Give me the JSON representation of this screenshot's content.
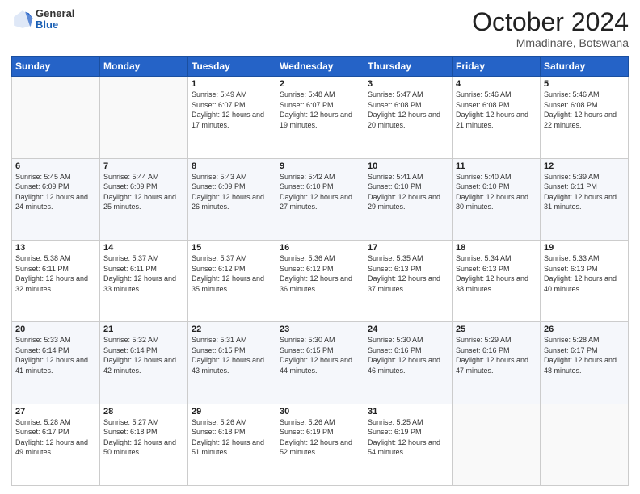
{
  "logo": {
    "general": "General",
    "blue": "Blue"
  },
  "header": {
    "month_year": "October 2024",
    "location": "Mmadinare, Botswana"
  },
  "days_of_week": [
    "Sunday",
    "Monday",
    "Tuesday",
    "Wednesday",
    "Thursday",
    "Friday",
    "Saturday"
  ],
  "weeks": [
    [
      {
        "day": "",
        "sunrise": "",
        "sunset": "",
        "daylight": ""
      },
      {
        "day": "",
        "sunrise": "",
        "sunset": "",
        "daylight": ""
      },
      {
        "day": "1",
        "sunrise": "Sunrise: 5:49 AM",
        "sunset": "Sunset: 6:07 PM",
        "daylight": "Daylight: 12 hours and 17 minutes."
      },
      {
        "day": "2",
        "sunrise": "Sunrise: 5:48 AM",
        "sunset": "Sunset: 6:07 PM",
        "daylight": "Daylight: 12 hours and 19 minutes."
      },
      {
        "day": "3",
        "sunrise": "Sunrise: 5:47 AM",
        "sunset": "Sunset: 6:08 PM",
        "daylight": "Daylight: 12 hours and 20 minutes."
      },
      {
        "day": "4",
        "sunrise": "Sunrise: 5:46 AM",
        "sunset": "Sunset: 6:08 PM",
        "daylight": "Daylight: 12 hours and 21 minutes."
      },
      {
        "day": "5",
        "sunrise": "Sunrise: 5:46 AM",
        "sunset": "Sunset: 6:08 PM",
        "daylight": "Daylight: 12 hours and 22 minutes."
      }
    ],
    [
      {
        "day": "6",
        "sunrise": "Sunrise: 5:45 AM",
        "sunset": "Sunset: 6:09 PM",
        "daylight": "Daylight: 12 hours and 24 minutes."
      },
      {
        "day": "7",
        "sunrise": "Sunrise: 5:44 AM",
        "sunset": "Sunset: 6:09 PM",
        "daylight": "Daylight: 12 hours and 25 minutes."
      },
      {
        "day": "8",
        "sunrise": "Sunrise: 5:43 AM",
        "sunset": "Sunset: 6:09 PM",
        "daylight": "Daylight: 12 hours and 26 minutes."
      },
      {
        "day": "9",
        "sunrise": "Sunrise: 5:42 AM",
        "sunset": "Sunset: 6:10 PM",
        "daylight": "Daylight: 12 hours and 27 minutes."
      },
      {
        "day": "10",
        "sunrise": "Sunrise: 5:41 AM",
        "sunset": "Sunset: 6:10 PM",
        "daylight": "Daylight: 12 hours and 29 minutes."
      },
      {
        "day": "11",
        "sunrise": "Sunrise: 5:40 AM",
        "sunset": "Sunset: 6:10 PM",
        "daylight": "Daylight: 12 hours and 30 minutes."
      },
      {
        "day": "12",
        "sunrise": "Sunrise: 5:39 AM",
        "sunset": "Sunset: 6:11 PM",
        "daylight": "Daylight: 12 hours and 31 minutes."
      }
    ],
    [
      {
        "day": "13",
        "sunrise": "Sunrise: 5:38 AM",
        "sunset": "Sunset: 6:11 PM",
        "daylight": "Daylight: 12 hours and 32 minutes."
      },
      {
        "day": "14",
        "sunrise": "Sunrise: 5:37 AM",
        "sunset": "Sunset: 6:11 PM",
        "daylight": "Daylight: 12 hours and 33 minutes."
      },
      {
        "day": "15",
        "sunrise": "Sunrise: 5:37 AM",
        "sunset": "Sunset: 6:12 PM",
        "daylight": "Daylight: 12 hours and 35 minutes."
      },
      {
        "day": "16",
        "sunrise": "Sunrise: 5:36 AM",
        "sunset": "Sunset: 6:12 PM",
        "daylight": "Daylight: 12 hours and 36 minutes."
      },
      {
        "day": "17",
        "sunrise": "Sunrise: 5:35 AM",
        "sunset": "Sunset: 6:13 PM",
        "daylight": "Daylight: 12 hours and 37 minutes."
      },
      {
        "day": "18",
        "sunrise": "Sunrise: 5:34 AM",
        "sunset": "Sunset: 6:13 PM",
        "daylight": "Daylight: 12 hours and 38 minutes."
      },
      {
        "day": "19",
        "sunrise": "Sunrise: 5:33 AM",
        "sunset": "Sunset: 6:13 PM",
        "daylight": "Daylight: 12 hours and 40 minutes."
      }
    ],
    [
      {
        "day": "20",
        "sunrise": "Sunrise: 5:33 AM",
        "sunset": "Sunset: 6:14 PM",
        "daylight": "Daylight: 12 hours and 41 minutes."
      },
      {
        "day": "21",
        "sunrise": "Sunrise: 5:32 AM",
        "sunset": "Sunset: 6:14 PM",
        "daylight": "Daylight: 12 hours and 42 minutes."
      },
      {
        "day": "22",
        "sunrise": "Sunrise: 5:31 AM",
        "sunset": "Sunset: 6:15 PM",
        "daylight": "Daylight: 12 hours and 43 minutes."
      },
      {
        "day": "23",
        "sunrise": "Sunrise: 5:30 AM",
        "sunset": "Sunset: 6:15 PM",
        "daylight": "Daylight: 12 hours and 44 minutes."
      },
      {
        "day": "24",
        "sunrise": "Sunrise: 5:30 AM",
        "sunset": "Sunset: 6:16 PM",
        "daylight": "Daylight: 12 hours and 46 minutes."
      },
      {
        "day": "25",
        "sunrise": "Sunrise: 5:29 AM",
        "sunset": "Sunset: 6:16 PM",
        "daylight": "Daylight: 12 hours and 47 minutes."
      },
      {
        "day": "26",
        "sunrise": "Sunrise: 5:28 AM",
        "sunset": "Sunset: 6:17 PM",
        "daylight": "Daylight: 12 hours and 48 minutes."
      }
    ],
    [
      {
        "day": "27",
        "sunrise": "Sunrise: 5:28 AM",
        "sunset": "Sunset: 6:17 PM",
        "daylight": "Daylight: 12 hours and 49 minutes."
      },
      {
        "day": "28",
        "sunrise": "Sunrise: 5:27 AM",
        "sunset": "Sunset: 6:18 PM",
        "daylight": "Daylight: 12 hours and 50 minutes."
      },
      {
        "day": "29",
        "sunrise": "Sunrise: 5:26 AM",
        "sunset": "Sunset: 6:18 PM",
        "daylight": "Daylight: 12 hours and 51 minutes."
      },
      {
        "day": "30",
        "sunrise": "Sunrise: 5:26 AM",
        "sunset": "Sunset: 6:19 PM",
        "daylight": "Daylight: 12 hours and 52 minutes."
      },
      {
        "day": "31",
        "sunrise": "Sunrise: 5:25 AM",
        "sunset": "Sunset: 6:19 PM",
        "daylight": "Daylight: 12 hours and 54 minutes."
      },
      {
        "day": "",
        "sunrise": "",
        "sunset": "",
        "daylight": ""
      },
      {
        "day": "",
        "sunrise": "",
        "sunset": "",
        "daylight": ""
      }
    ]
  ]
}
